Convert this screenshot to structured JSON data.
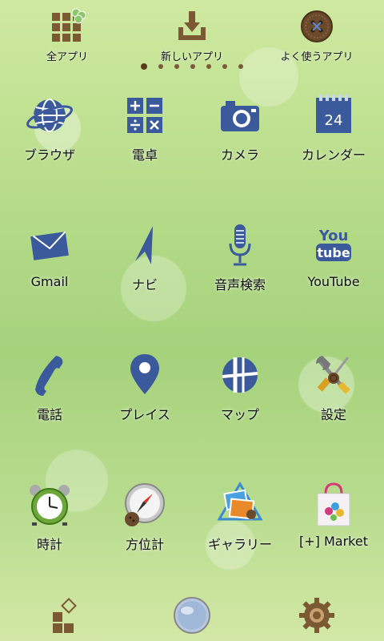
{
  "top": {
    "all_apps": "全アプリ",
    "new_apps": "新しいアプリ",
    "frequent_apps": "よく使うアプリ"
  },
  "page_indicator": {
    "count": 7,
    "active_index": 0
  },
  "apps": [
    {
      "label": "ブラウザ",
      "icon": "globe-icon"
    },
    {
      "label": "電卓",
      "icon": "calculator-icon"
    },
    {
      "label": "カメラ",
      "icon": "camera-icon"
    },
    {
      "label": "カレンダー",
      "icon": "calendar-icon"
    },
    {
      "label": "Gmail",
      "icon": "mail-icon"
    },
    {
      "label": "ナビ",
      "icon": "navigation-arrow-icon"
    },
    {
      "label": "音声検索",
      "icon": "microphone-icon"
    },
    {
      "label": "YouTube",
      "icon": "youtube-icon"
    },
    {
      "label": "電話",
      "icon": "phone-icon"
    },
    {
      "label": "プレイス",
      "icon": "map-pin-icon"
    },
    {
      "label": "マップ",
      "icon": "map-icon"
    },
    {
      "label": "設定",
      "icon": "settings-tools-icon"
    },
    {
      "label": "時計",
      "icon": "alarm-clock-icon"
    },
    {
      "label": "方位計",
      "icon": "compass-icon"
    },
    {
      "label": "ギャラリー",
      "icon": "gallery-icon"
    },
    {
      "label": "[+] Market",
      "icon": "market-bag-icon"
    }
  ],
  "calendar_icon_text": "24",
  "youtube_icon_text": [
    "You",
    "tube"
  ],
  "colors": {
    "icon_blue": "#3a5a9c",
    "brown": "#6b4a2b"
  }
}
